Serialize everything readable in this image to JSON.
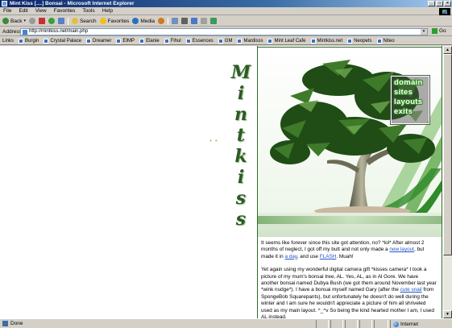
{
  "window": {
    "title": "Mint Kiss [....] Bonsai - Microsoft Internet Explorer",
    "controls": [
      "_",
      "□",
      "×"
    ]
  },
  "menu": [
    "File",
    "Edit",
    "View",
    "Favorites",
    "Tools",
    "Help"
  ],
  "toolbar": {
    "back_label": "Back",
    "search_label": "Search",
    "favorites_label": "Favorites",
    "media_label": "Media"
  },
  "address": {
    "label": "Address",
    "url": "http://mintkiss.net/main.php",
    "go_label": "Go"
  },
  "links": {
    "label": "Links",
    "items": [
      "Burgin",
      "Crystal Palace",
      "Dreamer",
      "EIMP",
      "Elanie",
      "Fihul",
      "Essences",
      "GM",
      "Mardisss",
      "Mint Leaf Cafe",
      "Mintkiss.net",
      "Neopets",
      "Niteo"
    ]
  },
  "page": {
    "vertical_title": [
      "M",
      "i",
      "n",
      "t",
      "k",
      "i",
      "s",
      "s"
    ],
    "dots": "• •",
    "nav": [
      "domain",
      "sites",
      "layouts",
      "exits"
    ],
    "post": {
      "p1": [
        "It seems like forever since this site got attention, no? *lol* After almost 2 months of neglect, I got off my butt and not only made a ",
        "new layout",
        ", but made it in ",
        "a day",
        ", and use ",
        "FLASH",
        ". Muah!"
      ],
      "p2_start": "Yet again using my wonderful digital camera gift *kisses camera* I took a picture of my mum's bonsai tree, AL. Yes, AL, as in Al Gore. We have another bonsai named Dubya Bush (we got them around November last year *wink nudge*). I have a bonsai myself named Gary (after the ",
      "p2_link": "cute snail",
      "p2_end": " from SpongeBob Squarepants), but unfortunately he doesn't do well during the winter and I am sure he wouldn't appreciate a picture of him all shriveled used as my main layout. ^_^v So being the kind hearted mother I am, I used AL instead."
    }
  },
  "status": {
    "text": "Done",
    "zone": "Internet"
  },
  "colors": {
    "accent_green": "#2f6b29",
    "nav_text_outline": "#2c8a1e",
    "link_blue": "#2453c8"
  }
}
